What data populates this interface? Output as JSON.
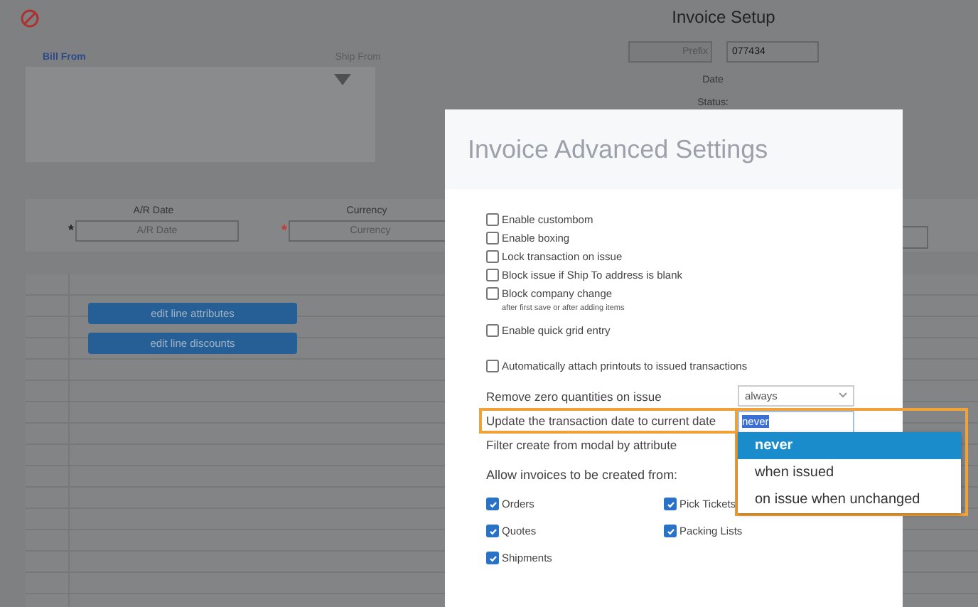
{
  "page": {
    "title": "Invoice Setup",
    "bill_from": "Bill From",
    "ship_from": "Ship From",
    "prefix": {
      "label": "Prefix",
      "value": "077434"
    },
    "date_label": "Date",
    "status_label": "Status:",
    "header_fields": [
      {
        "label": "A/R Date",
        "placeholder": "A/R Date",
        "marker": "*",
        "color": "#222222"
      },
      {
        "label": "Currency",
        "placeholder": "Currency",
        "marker": "*",
        "color": "#cc3333"
      }
    ],
    "grid_buttons": [
      "edit line attributes",
      "edit line discounts"
    ]
  },
  "modal": {
    "title": "Invoice Advanced Settings",
    "options": [
      {
        "label": "Enable custombom",
        "checked": false
      },
      {
        "label": "Enable boxing",
        "checked": false
      },
      {
        "label": "Lock transaction on issue",
        "checked": false
      },
      {
        "label": "Block issue if Ship To address is blank",
        "checked": false
      },
      {
        "label": "Block company change",
        "checked": false,
        "note": "after first save or after adding items"
      },
      {
        "label": "Enable quick grid entry",
        "checked": false
      }
    ],
    "attach_option": {
      "label": "Automatically attach printouts to issued transactions",
      "checked": false
    },
    "settings": [
      {
        "kind": "select",
        "label": "Remove zero quantities on issue",
        "value": "always",
        "highlighted": false
      },
      {
        "kind": "input",
        "label": "Update the transaction date to current date",
        "value": "never",
        "highlighted": true,
        "dropdown": {
          "highlighted": true,
          "options": [
            {
              "label": "never",
              "selected": true
            },
            {
              "label": "when issued",
              "selected": false
            },
            {
              "label": "on issue when unchanged",
              "selected": false
            }
          ]
        }
      },
      {
        "kind": "text",
        "label": "Filter create from modal by attribute",
        "highlighted": false
      }
    ],
    "sources_label": "Allow invoices to be created from:",
    "sources": [
      {
        "label": "Orders",
        "checked": true
      },
      {
        "label": "Pick Tickets",
        "checked": true
      },
      {
        "label": "Quotes",
        "checked": true
      },
      {
        "label": "Packing Lists",
        "checked": true
      },
      {
        "label": "Shipments",
        "checked": true
      }
    ]
  }
}
